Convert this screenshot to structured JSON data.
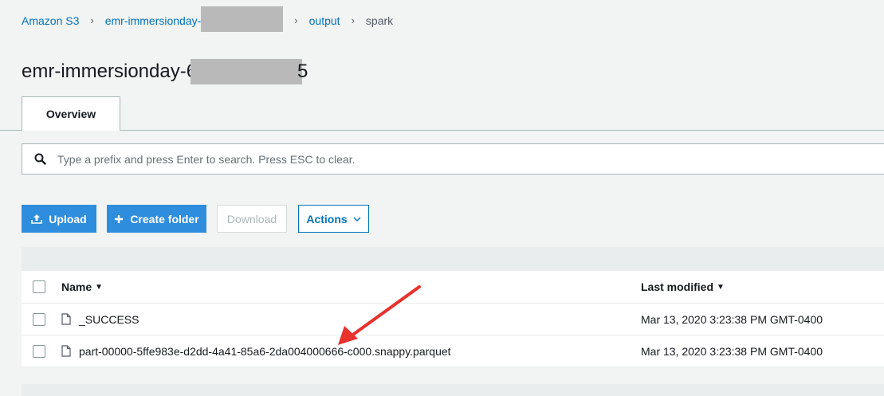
{
  "breadcrumb": {
    "root": "Amazon S3",
    "bucket": "emr-immersionday-",
    "folder1": "output",
    "folder2": "spark"
  },
  "page": {
    "title_prefix": "emr-immersionday-6",
    "title_suffix": "5"
  },
  "tabs": {
    "overview": "Overview"
  },
  "search": {
    "placeholder": "Type a prefix and press Enter to search. Press ESC to clear."
  },
  "toolbar": {
    "upload": "Upload",
    "create_folder": "Create folder",
    "download": "Download",
    "actions": "Actions"
  },
  "table": {
    "headers": {
      "name": "Name",
      "last_modified": "Last modified"
    },
    "rows": [
      {
        "name": "_SUCCESS",
        "last_modified": "Mar 13, 2020 3:23:38 PM GMT-0400"
      },
      {
        "name": "part-00000-5ffe983e-d2dd-4a41-85a6-2da004000666-c000.snappy.parquet",
        "last_modified": "Mar 13, 2020 3:23:38 PM GMT-0400"
      }
    ]
  },
  "colors": {
    "link": "#0073bb",
    "primary_button": "#2e8ddc",
    "annotation_arrow": "#e8322d",
    "background": "#f2f3f3"
  }
}
